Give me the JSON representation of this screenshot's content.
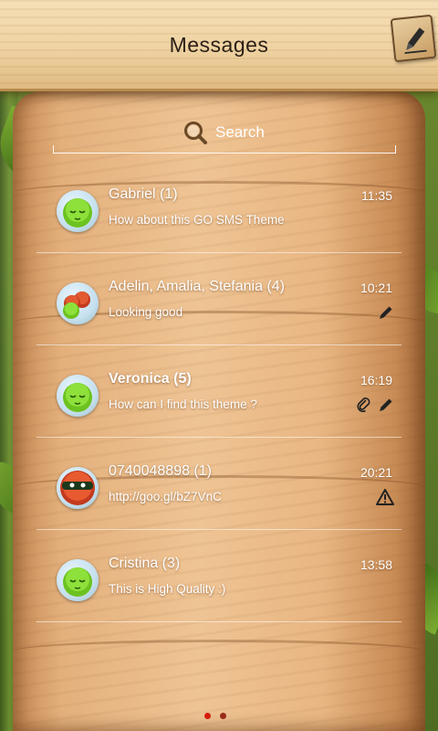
{
  "header": {
    "title": "Messages"
  },
  "search": {
    "label": "Search"
  },
  "conversations": [
    {
      "name": "Gabriel (1)",
      "preview": "How about this GO SMS Theme",
      "time": "11:35",
      "bold": false,
      "avatar": "green-sleepy-face",
      "status": []
    },
    {
      "name": "Adelin, Amalia, Stefania (4)",
      "preview": "Looking good",
      "time": "10:21",
      "bold": false,
      "avatar": "group-faces",
      "status": [
        "pencil-icon"
      ]
    },
    {
      "name": "Veronica (5)",
      "preview": "How can I find this theme ?",
      "time": "16:19",
      "bold": true,
      "avatar": "green-sleepy-face",
      "status": [
        "paperclip-icon",
        "pencil-icon"
      ]
    },
    {
      "name": "0740048898 (1)",
      "preview": "http://goo.gl/bZ7VnC",
      "time": "20:21",
      "bold": false,
      "avatar": "red-masked-face",
      "status": [
        "warning-icon"
      ]
    },
    {
      "name": "Cristina (3)",
      "preview": "This is High Quality :)",
      "time": "13:58",
      "bold": false,
      "avatar": "green-sleepy-face",
      "status": []
    }
  ],
  "pager": {
    "active": 0,
    "count": 2
  },
  "colors": {
    "accent": "#d31c0c",
    "text": "#ffffff",
    "header_text": "#2b2018"
  }
}
